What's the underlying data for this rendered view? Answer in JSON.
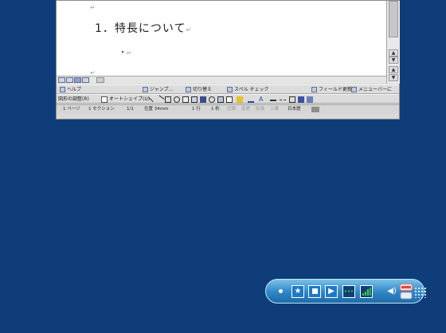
{
  "document": {
    "heading": "1．特長について",
    "bullet": "・",
    "para_mark": "↵",
    "paragraph_marks": [
      "↵",
      "↵",
      "↵"
    ]
  },
  "toolbar1": {
    "items": [
      {
        "label": "ヘルプ"
      },
      {
        "label": "ジャンプ..."
      },
      {
        "label": "切り替え"
      },
      {
        "label": "スペル チェック"
      },
      {
        "label": "フィールド更新"
      },
      {
        "label": "メニューバーに"
      }
    ]
  },
  "toolbar2": {
    "draw_label": "図形の調整(R)",
    "autoshape_label": "オートシェイプ(U)"
  },
  "statusbar": {
    "page": "1 ページ",
    "section": "1 セクション",
    "page_of": "1/1",
    "position": "位置 34mm",
    "line": "1 行",
    "column": "1 桁",
    "rec": "記録",
    "trk": "変更",
    "ext": "拡張",
    "ovr": "上書",
    "language": "日本語"
  },
  "taskbar": {
    "icons": [
      "dot-icon",
      "star-icon",
      "stop-icon",
      "play-icon",
      "sound-meter-icon",
      "signal-icon",
      "speaker-icon",
      "keyboard-icon",
      "grip-icon"
    ],
    "accent": "#2f86c6"
  },
  "colors": {
    "desktop": "#0f3d79",
    "toolbar": "#dcdcdc"
  }
}
